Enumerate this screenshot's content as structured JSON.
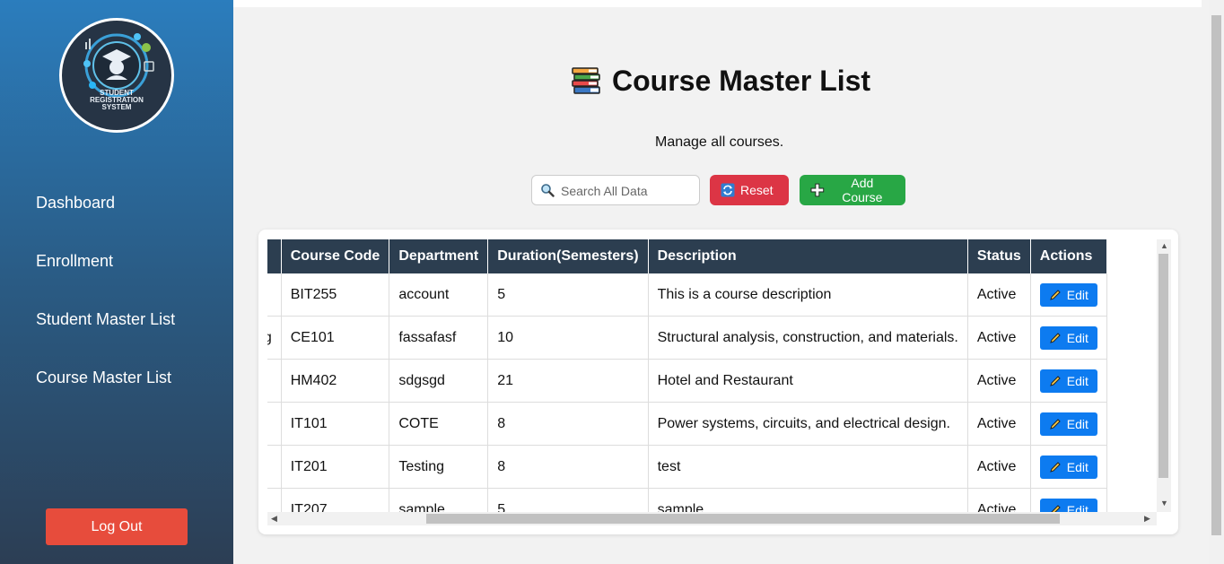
{
  "sidebar": {
    "logo_text": [
      "STUDENT",
      "REGISTRATION",
      "SYSTEM"
    ],
    "items": [
      {
        "label": "Dashboard"
      },
      {
        "label": "Enrollment"
      },
      {
        "label": "Student Master List"
      },
      {
        "label": "Course Master List"
      }
    ],
    "logout_label": "Log Out"
  },
  "header": {
    "title": "Course Master List",
    "subtitle": "Manage all courses."
  },
  "toolbar": {
    "search_placeholder": "Search All Data",
    "reset_label": "Reset",
    "add_label": "Add Course"
  },
  "table": {
    "columns": [
      "",
      "Course Code",
      "Department",
      "Duration(Semesters)",
      "Description",
      "Status",
      "Actions"
    ],
    "rows": [
      {
        "name": "",
        "code": "BIT255",
        "dept": "account",
        "duration": "5",
        "description": "This is a course description",
        "status": "Active"
      },
      {
        "name": "ngineering",
        "code": "CE101",
        "dept": "fassafasf",
        "duration": "10",
        "description": "Structural analysis, construction, and materials.",
        "status": "Active"
      },
      {
        "name": "",
        "code": "HM402",
        "dept": "sdgsgd",
        "duration": "21",
        "description": "Hotel and Restaurant",
        "status": "Active"
      },
      {
        "name": "",
        "code": "IT101",
        "dept": "COTE",
        "duration": "8",
        "description": "Power systems, circuits, and electrical design.",
        "status": "Active"
      },
      {
        "name": "",
        "code": "IT201",
        "dept": "Testing",
        "duration": "8",
        "description": "test",
        "status": "Active"
      },
      {
        "name": "",
        "code": "IT207",
        "dept": "sample",
        "duration": "5",
        "description": "sample",
        "status": "Active"
      }
    ],
    "edit_label": "Edit"
  },
  "colors": {
    "header_bg": "#2c3e50",
    "reset": "#dc3545",
    "add": "#28a745",
    "edit": "#0d7bf0",
    "logout": "#e74c3c"
  }
}
